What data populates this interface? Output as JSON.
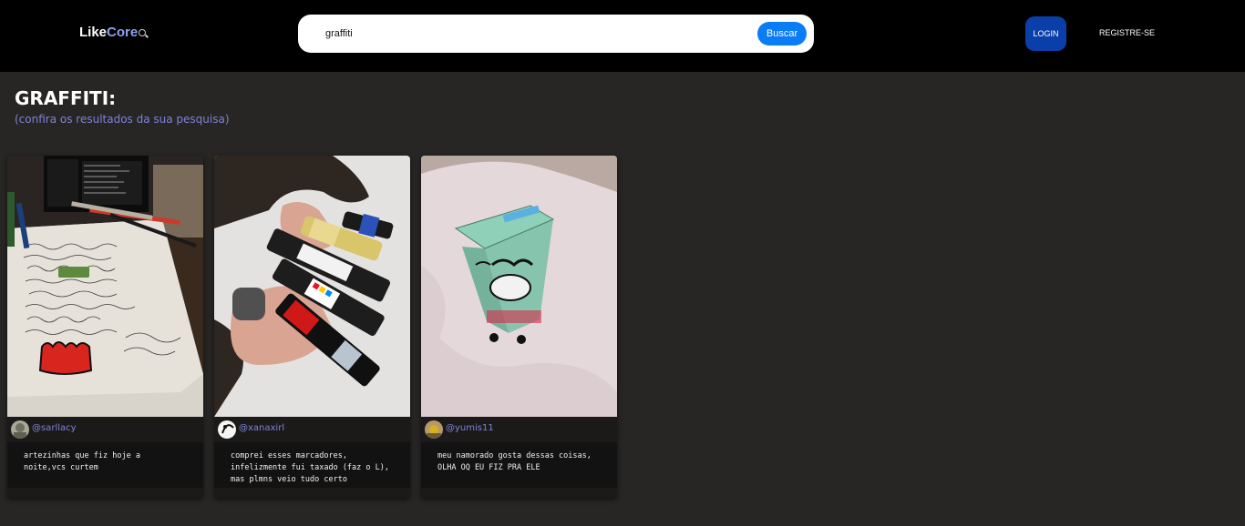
{
  "header": {
    "logo_like": "Like",
    "logo_core": "Core",
    "search_value": "graffiti",
    "search_button": "Buscar",
    "login_button": "LOGIN",
    "register_link": "REGISTRE-SE"
  },
  "results": {
    "title": "GRAFFITI:",
    "subtitle": "(confira os resultados da sua pesquisa)"
  },
  "posts": [
    {
      "username": "@sarllacy",
      "caption": "artezinhas que fiz hoje a noite,vcs curtem"
    },
    {
      "username": "@xanaxirl",
      "caption": "comprei esses marcadores, infelizmente fui taxado (faz o L), mas plmns veio tudo certo"
    },
    {
      "username": "@yumis11",
      "caption": "meu namorado gosta dessas coisas, OLHA OQ EU FIZ PRA ELE"
    }
  ],
  "colors": {
    "header_bg": "#000000",
    "page_bg": "#272624",
    "accent_blue": "#0a7cf5",
    "login_blue": "#0a3fa9",
    "link_purple": "#7d83d9"
  }
}
